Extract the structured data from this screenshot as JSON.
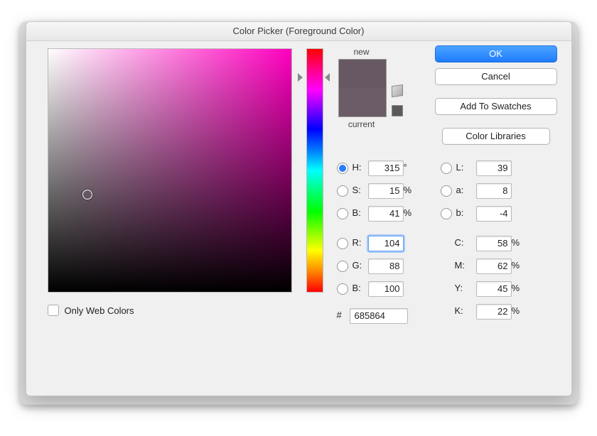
{
  "title": "Color Picker (Foreground Color)",
  "preview": {
    "new": "new",
    "current": "current",
    "newColor": "#685864",
    "curColor": "#6c5c67"
  },
  "webcolors": "Only Web Colors",
  "buttons": {
    "ok": "OK",
    "cancel": "Cancel",
    "swatches": "Add To Swatches",
    "libraries": "Color Libraries"
  },
  "hsb": {
    "H": {
      "label": "H:",
      "value": "315",
      "unit": "°"
    },
    "S": {
      "label": "S:",
      "value": "15",
      "unit": "%"
    },
    "B": {
      "label": "B:",
      "value": "41",
      "unit": "%"
    }
  },
  "rgb": {
    "R": {
      "label": "R:",
      "value": "104"
    },
    "G": {
      "label": "G:",
      "value": "88"
    },
    "B": {
      "label": "B:",
      "value": "100"
    }
  },
  "lab": {
    "L": {
      "label": "L:",
      "value": "39"
    },
    "a": {
      "label": "a:",
      "value": "8"
    },
    "b": {
      "label": "b:",
      "value": "-4"
    }
  },
  "cmyk": {
    "C": {
      "label": "C:",
      "value": "58",
      "unit": "%"
    },
    "M": {
      "label": "M:",
      "value": "62",
      "unit": "%"
    },
    "Y": {
      "label": "Y:",
      "value": "45",
      "unit": "%"
    },
    "K": {
      "label": "K:",
      "value": "22",
      "unit": "%"
    }
  },
  "hex": {
    "prefix": "#",
    "value": "685864"
  }
}
